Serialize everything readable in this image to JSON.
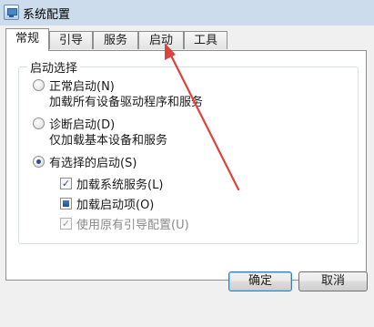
{
  "window": {
    "title": "系统配置",
    "icon": "system-config-icon"
  },
  "tabs": [
    {
      "label": "常规",
      "active": true
    },
    {
      "label": "引导",
      "active": false
    },
    {
      "label": "服务",
      "active": false
    },
    {
      "label": "启动",
      "active": false
    },
    {
      "label": "工具",
      "active": false
    }
  ],
  "startup_selection": {
    "caption": "启动选择",
    "options": [
      {
        "label": "正常启动(N)",
        "description": "加载所有设备驱动程序和服务",
        "checked": false
      },
      {
        "label": "诊断启动(D)",
        "description": "仅加载基本设备和服务",
        "checked": false
      },
      {
        "label": "有选择的启动(S)",
        "checked": true
      }
    ],
    "selective_items": [
      {
        "label": "加载系统服务(L)",
        "state": "checked",
        "symbol": "✓"
      },
      {
        "label": "加载启动项(O)",
        "state": "indeterminate"
      },
      {
        "label": "使用原有引导配置(U)",
        "state": "checked-disabled",
        "symbol": "✓"
      }
    ]
  },
  "buttons": {
    "ok": "确定",
    "cancel": "取消"
  },
  "annotation": {
    "color": "#e0413a",
    "points_to": "tab-startup"
  }
}
